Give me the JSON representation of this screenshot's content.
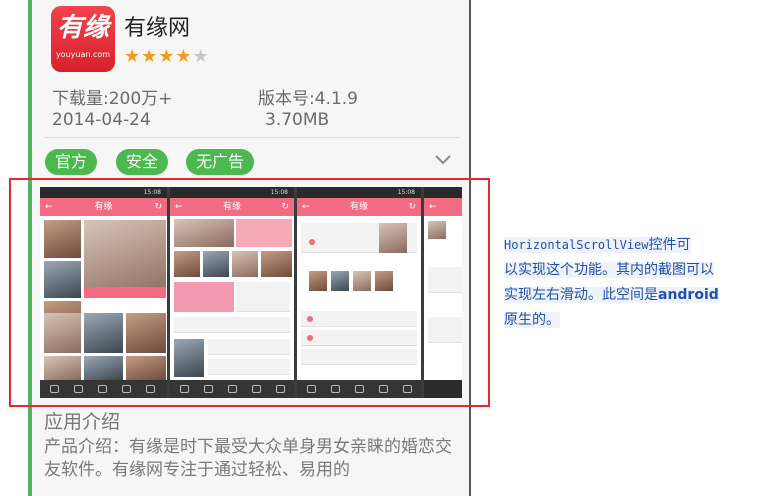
{
  "app": {
    "icon_glyph": "有缘",
    "icon_domain": "youyuan.com",
    "name": "有缘网",
    "rating_stars": 4,
    "rating_max": 5
  },
  "info": {
    "downloads": "下载量:200万+",
    "version": "版本号:4.1.9",
    "date": "2014-04-24",
    "size": "3.70MB"
  },
  "tags": [
    "官方",
    "安全",
    "无广告"
  ],
  "screenshots": {
    "title": "有缘",
    "status_time": "15:08"
  },
  "section": {
    "title": "应用介绍",
    "description": "产品介绍：有缘是时下最受大众单身男女亲睐的婚恋交友软件。有缘网专注于通过轻松、易用的"
  },
  "annotation": {
    "line1_code": "HorizontalScrollView",
    "line1_rest": "控件可",
    "line2": "以实现这个功能。其内的截图可以",
    "line3_pre": "实现左右滑动。此空间是",
    "line3_bold": "android",
    "line4": "原生的。"
  },
  "colors": {
    "accent_green": "#4bb94e",
    "highlight_red": "#e52a2a",
    "annotation_blue": "#1f4fb4",
    "app_pink": "#f26b83"
  },
  "icons": [
    "chevron-down-icon",
    "star-icon"
  ]
}
